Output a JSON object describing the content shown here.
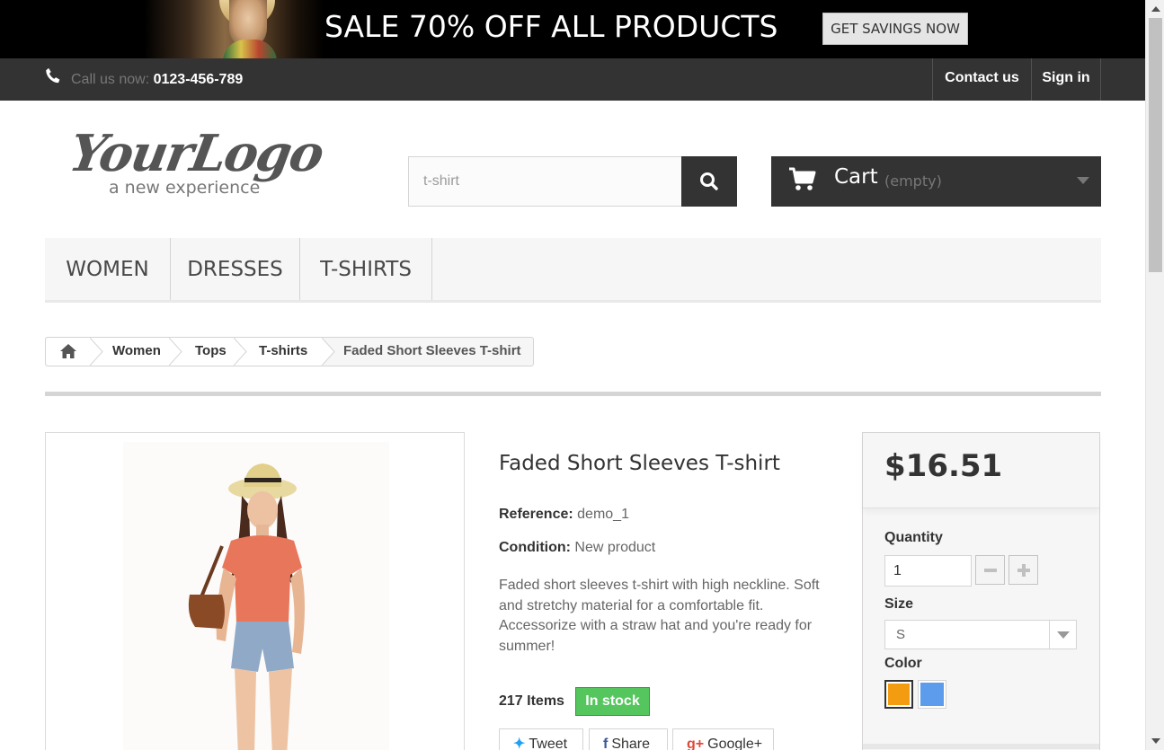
{
  "banner": {
    "text": "SALE 70% OFF ALL PRODUCTS",
    "button_label": "GET SAVINGS NOW"
  },
  "topbar": {
    "call_label": "Call us now:",
    "phone": "0123-456-789",
    "contact_label": "Contact us",
    "signin_label": "Sign in"
  },
  "logo": {
    "main": "YourLogo",
    "tagline": "a new experience"
  },
  "search": {
    "value": "t-shirt",
    "icon": "search-icon"
  },
  "cart": {
    "label": "Cart",
    "status": "(empty)",
    "icon": "cart-icon"
  },
  "menu": {
    "items": [
      {
        "label": "WOMEN"
      },
      {
        "label": "DRESSES"
      },
      {
        "label": "T-SHIRTS"
      }
    ]
  },
  "breadcrumb": {
    "home_icon": "home-icon",
    "items": [
      "Women",
      "Tops",
      "T-shirts"
    ],
    "current": "Faded Short Sleeves T-shirt"
  },
  "product": {
    "name": "Faded Short Sleeves T-shirt",
    "reference_label": "Reference:",
    "reference": "demo_1",
    "condition_label": "Condition:",
    "condition": "New product",
    "description": "Faded short sleeves t-shirt with high neckline. Soft and stretchy material for a comfortable fit. Accessorize with a straw hat and you're ready for summer!",
    "stock_count": "217 Items",
    "stock_status": "In stock",
    "stock_color": "#55c65e"
  },
  "social": {
    "tweet": "Tweet",
    "share": "Share",
    "gplus": "Google+"
  },
  "buybox": {
    "price": "$16.51",
    "quantity_label": "Quantity",
    "quantity_value": "1",
    "size_label": "Size",
    "size_value": "S",
    "color_label": "Color",
    "colors": [
      "#f39c11",
      "#5d9cec"
    ]
  }
}
